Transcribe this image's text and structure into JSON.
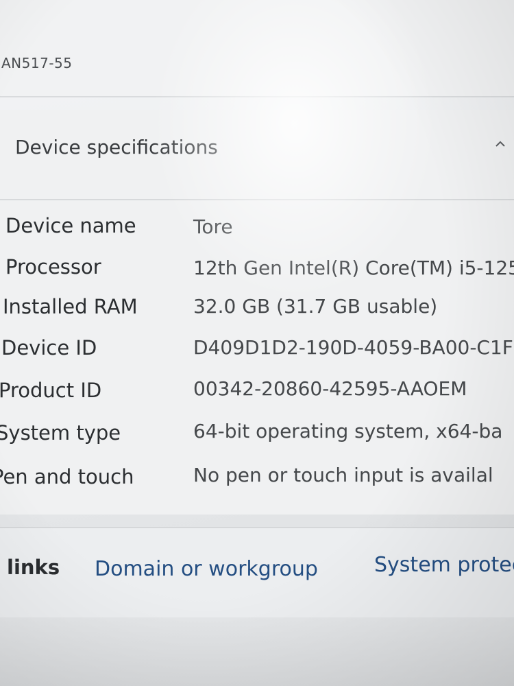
{
  "header": {
    "model": "AN517-55"
  },
  "specs": {
    "title": "Device specifications",
    "rows": [
      {
        "label": "Device name",
        "value": "Tore"
      },
      {
        "label": "Processor",
        "value": "12th Gen Intel(R) Core(TM) i5-125"
      },
      {
        "label": "Installed RAM",
        "value": "32.0 GB (31.7 GB usable)"
      },
      {
        "label": "Device ID",
        "value": "D409D1D2-190D-4059-BA00-C1F"
      },
      {
        "label": "Product ID",
        "value": "00342-20860-42595-AAOEM"
      },
      {
        "label": "System type",
        "value": "64-bit operating system, x64-ba"
      },
      {
        "label": "Pen and touch",
        "value": "No pen or touch input is availal"
      }
    ]
  },
  "links": {
    "label": "links",
    "items": [
      "Domain or workgroup",
      "System protec"
    ]
  }
}
